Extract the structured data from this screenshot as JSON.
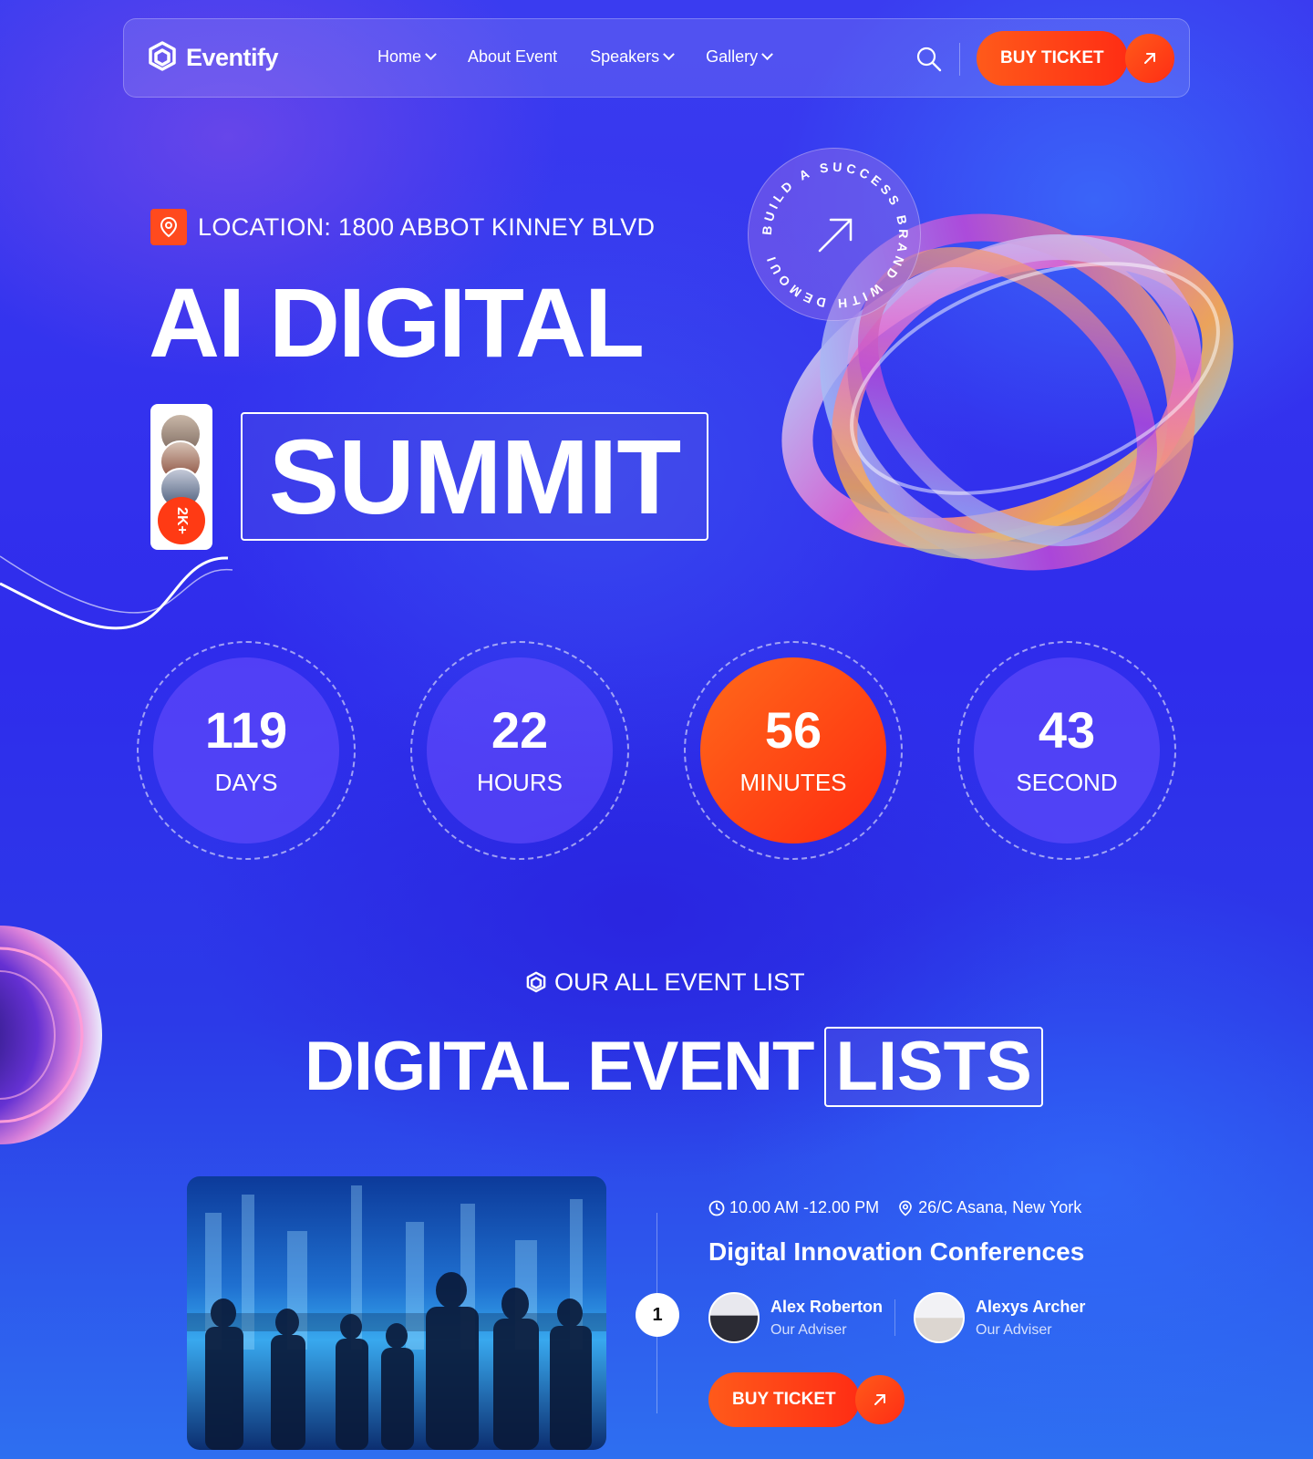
{
  "brand": {
    "name": "Eventify"
  },
  "nav": {
    "items": [
      {
        "label": "Home",
        "has_dropdown": true
      },
      {
        "label": "About Event",
        "has_dropdown": false
      },
      {
        "label": "Speakers",
        "has_dropdown": true
      },
      {
        "label": "Gallery",
        "has_dropdown": true
      }
    ],
    "buy_label": "BUY TICKET"
  },
  "hero": {
    "location": "LOCATION: 1800 ABBOT KINNEY BLVD",
    "title_line1": "AI DIGITAL",
    "title_line2": "SUMMIT",
    "attendee_count": "2K+",
    "badge_text": "BUILD A SUCCESS BRAND WITH DEMOUI"
  },
  "countdown": [
    {
      "value": "119",
      "label": "DAYS",
      "active": false
    },
    {
      "value": "22",
      "label": "HOURS",
      "active": false
    },
    {
      "value": "56",
      "label": "MINUTES",
      "active": true
    },
    {
      "value": "43",
      "label": "SECOND",
      "active": false
    }
  ],
  "events_section": {
    "tag": "OUR ALL EVENT LIST",
    "title_plain": "DIGITAL EVENT",
    "title_boxed": "LISTS"
  },
  "event": {
    "index": "1",
    "time": "10.00 AM -12.00 PM",
    "place": "26/C Asana, New York",
    "title": "Digital Innovation Conferences",
    "speakers": [
      {
        "name": "Alex Roberton",
        "role": "Our Adviser"
      },
      {
        "name": "Alexys Archer",
        "role": "Our Adviser"
      }
    ],
    "buy_label": "BUY TICKET"
  },
  "colors": {
    "accent": "#ff4a1e",
    "bg": "#3434ee"
  },
  "icons": [
    "eventify-logo-icon",
    "chevron-down-icon",
    "search-icon",
    "arrow-up-right-icon",
    "location-pin-icon",
    "clock-icon"
  ]
}
